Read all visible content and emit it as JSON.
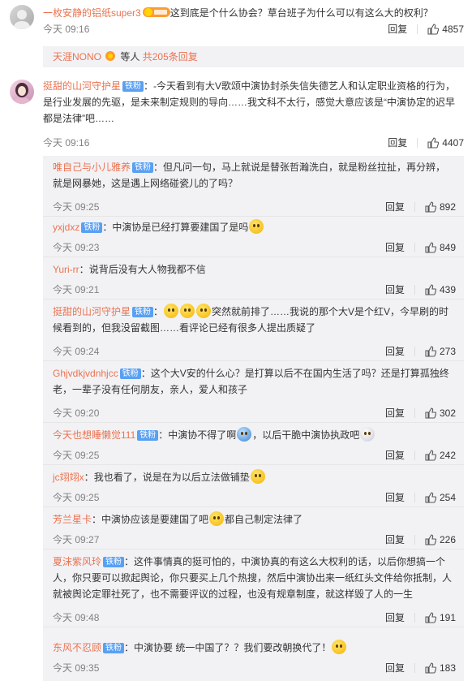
{
  "comments": [
    {
      "user": "一枚安静的铝纸super3",
      "text": "这到底是个什么协会？草台班子为什么可以有这么大的权利？",
      "time": "今天 09:16",
      "reply_label": "回复",
      "likes": "4857"
    },
    {
      "user": "挺甜的山河守护星",
      "badge": "铁粉",
      "text": "-今天看到有大V歌颂中演协封杀失信失德艺人和认定职业资格的行为，是行业发展的先驱，是未来制定规则的导向……我文科不太行，感觉大意应该是“中演协定的迟早都是法律”吧……",
      "time": "今天 09:16",
      "reply_label": "回复",
      "likes": "4407"
    }
  ],
  "replies_summary": {
    "user": "天涯NONO",
    "text": "等人",
    "count": "共205条回复"
  },
  "replies": [
    {
      "user": "唯自己与小儿雅养",
      "badge": "铁粉",
      "text": "但凡问一句，马上就说是替张哲瀚洗白，就是粉丝拉扯，再分辨，就是网暴她，这是遇上网络碰瓷儿的了吗？",
      "time": "今天 09:25",
      "reply_label": "回复",
      "likes": "892"
    },
    {
      "user": "yxjdxz",
      "badge": "铁粉",
      "text": "中演协是已经打算要建国了是吗",
      "time": "今天 09:23",
      "reply_label": "回复",
      "likes": "849"
    },
    {
      "user": "Yuri-rr",
      "text": "说背后没有大人物我都不信",
      "time": "今天 09:21",
      "reply_label": "回复",
      "likes": "439"
    },
    {
      "user": "挺甜的山河守护星",
      "badge": "铁粉",
      "text": "突然就前排了……我说的那个大V是个红V，今早刷的时候看到的，但我没留截图……看评论已经有很多人提出质疑了",
      "time": "今天 09:24",
      "reply_label": "回复",
      "likes": "273"
    },
    {
      "user": "Ghjvdkjvdnhjcc",
      "badge": "铁粉",
      "text": "这个大V安的什么心？是打算以后不在国内生活了吗？还是打算孤独终老，一辈子没有任何朋友，亲人，爱人和孩子",
      "time": "今天 09:20",
      "reply_label": "回复",
      "likes": "302"
    },
    {
      "user": "今天也想睡懒觉111",
      "badge": "铁粉",
      "text_a": "中演协不得了啊",
      "text_b": "，以后干脆中演协执政吧",
      "time": "今天 09:25",
      "reply_label": "回复",
      "likes": "242"
    },
    {
      "user": "jc翊翊x",
      "text": "我也看了，说是在为以后立法做铺垫",
      "time": "今天 09:25",
      "reply_label": "回复",
      "likes": "254"
    },
    {
      "user": "芳兰星卡",
      "text_a": "中演协应该是要建国了吧",
      "text_b": "都自己制定法律了",
      "time": "今天 09:27",
      "reply_label": "回复",
      "likes": "226"
    },
    {
      "user": "夏沫紫风玲",
      "badge": "铁粉",
      "text": "这件事情真的挺可怕的，中演协真的有这么大权利的话，以后你想搞一个人，你只要可以掀起舆论，你只要买上几个热搜，然后中演协出来一纸红头文件给你抵制，人就被舆论定罪社死了，也不需要评议的过程，也没有规章制度，就这样毁了人的一生",
      "time": "今天 09:48",
      "reply_label": "回复",
      "likes": "191"
    },
    {
      "user": "东风不忍顾",
      "badge": "铁粉",
      "text": "中演协要 统一中国了？？我们要改朝换代了！",
      "time": "今天 09:35",
      "reply_label": "回复",
      "likes": "183"
    }
  ],
  "colors": {
    "username": "#eb7350",
    "badge": "#59a0f3",
    "panel": "#f2f2f5"
  }
}
